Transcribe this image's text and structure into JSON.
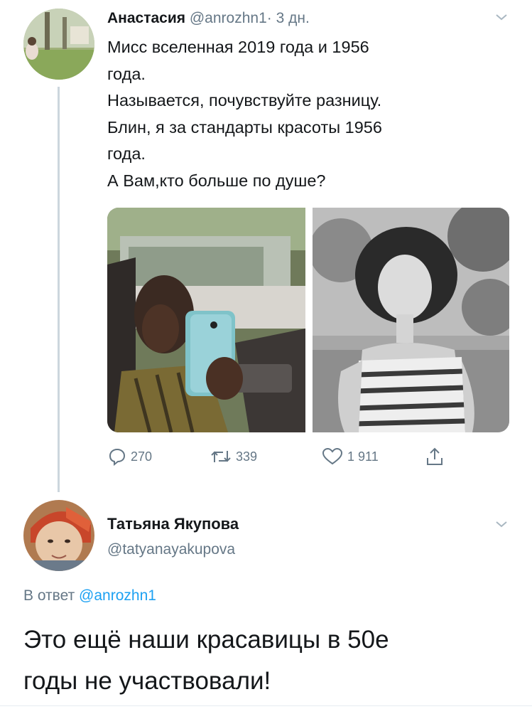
{
  "tweet": {
    "author_name": "Анастасия",
    "handle": "@anrozhn1",
    "separator": "·",
    "time": "3 дн.",
    "text_lines": [
      "Мисс вселенная 2019 года и 1956",
      "года.",
      "Называется, почувствуйте разницу.",
      "Блин, я за стандарты красоты 1956",
      "года.",
      "А Вам,кто  больше по душе?"
    ],
    "actions": {
      "replies": "270",
      "retweets": "339",
      "likes": "1 911"
    }
  },
  "reply": {
    "author_name": "Татьяна Якупова",
    "handle": "@tatyanayakupova",
    "reply_prefix": "В ответ",
    "reply_to": "@anrozhn1",
    "text_lines": [
      "Это ещё наши красавицы в 50е",
      "годы не участвовали!"
    ]
  },
  "colors": {
    "secondary_text": "#657786",
    "link": "#1da1f2",
    "thread_line": "#ccd6dd"
  },
  "icons": [
    "chevron-down-icon",
    "reply-icon",
    "retweet-icon",
    "like-icon",
    "share-icon"
  ]
}
